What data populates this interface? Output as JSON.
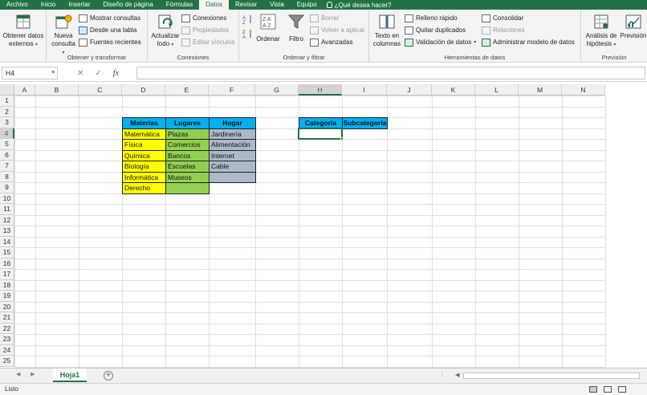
{
  "tabs": [
    "Archivo",
    "Inicio",
    "Insertar",
    "Diseño de página",
    "Fórmulas",
    "Datos",
    "Revisar",
    "Vista",
    "Equipo"
  ],
  "active_tab_index": 5,
  "tell_me": "¿Qué desea hacer?",
  "ribbon": {
    "get_external": {
      "line1": "Obtener datos",
      "line2": "externos"
    },
    "new_query": {
      "line1": "Nueva",
      "line2": "consulta"
    },
    "show_queries": "Mostrar consultas",
    "from_table": "Desde una tabla",
    "recent_sources": "Fuentes recientes",
    "group_get_transform": "Obtener y transformar",
    "refresh_all": {
      "line1": "Actualizar",
      "line2": "todo"
    },
    "connections": "Conexiones",
    "properties": "Propiedades",
    "edit_links": "Editar vínculos",
    "group_connections": "Conexiones",
    "sort": "Ordenar",
    "filter": "Filtro",
    "clear": "Borrar",
    "reapply": "Volver a aplicar",
    "advanced": "Avanzadas",
    "group_sort_filter": "Ordenar y filtrar",
    "text_to_columns": {
      "line1": "Texto en",
      "line2": "columnas"
    },
    "flash_fill": "Relleno rápido",
    "remove_duplicates": "Quitar duplicados",
    "data_validation": "Validación de datos",
    "consolidate": "Consolidar",
    "relationships": "Relaciones",
    "manage_model": "Administrar modelo de datos",
    "group_data_tools": "Herramientas de datos",
    "what_if": {
      "line1": "Análisis de",
      "line2": "hipótesis"
    },
    "forecast": {
      "line1": "Previsión",
      "line2": ""
    },
    "group_forecast": "Previsión"
  },
  "name_box": "H4",
  "fx_label": "fx",
  "columns": [
    "A",
    "B",
    "C",
    "D",
    "E",
    "F",
    "G",
    "H",
    "I",
    "J",
    "K",
    "L",
    "M",
    "N"
  ],
  "selected_column": "H",
  "rows": [
    "1",
    "2",
    "3",
    "4",
    "5",
    "6",
    "7",
    "8",
    "9",
    "10",
    "11",
    "12",
    "13",
    "14",
    "15",
    "16",
    "17",
    "18",
    "19",
    "20",
    "21",
    "22",
    "23",
    "24",
    "25"
  ],
  "selected_row": "4",
  "table1": {
    "headers": [
      "Materias",
      "Lugares",
      "Hogar"
    ],
    "materias": [
      "Matemática",
      "Física",
      "Química",
      "Biología",
      "Informática",
      "Derecho"
    ],
    "lugares": [
      "Plazas",
      "Comercios",
      "Bancos",
      "Escuelas",
      "Museos",
      ""
    ],
    "hogar": [
      "Jardinería",
      "Alimentación",
      "Internet",
      "Cable",
      "",
      ""
    ]
  },
  "table2": {
    "headers": [
      "Categoría",
      "Subcategoría"
    ]
  },
  "colors": {
    "header_fill": "#00b0f0",
    "materias_fill": "#ffff00",
    "lugares_fill": "#92d050",
    "hogar_fill": "#acb9ca",
    "excel_green": "#217346"
  },
  "sheet_tab": "Hoja1",
  "status": "Listo"
}
